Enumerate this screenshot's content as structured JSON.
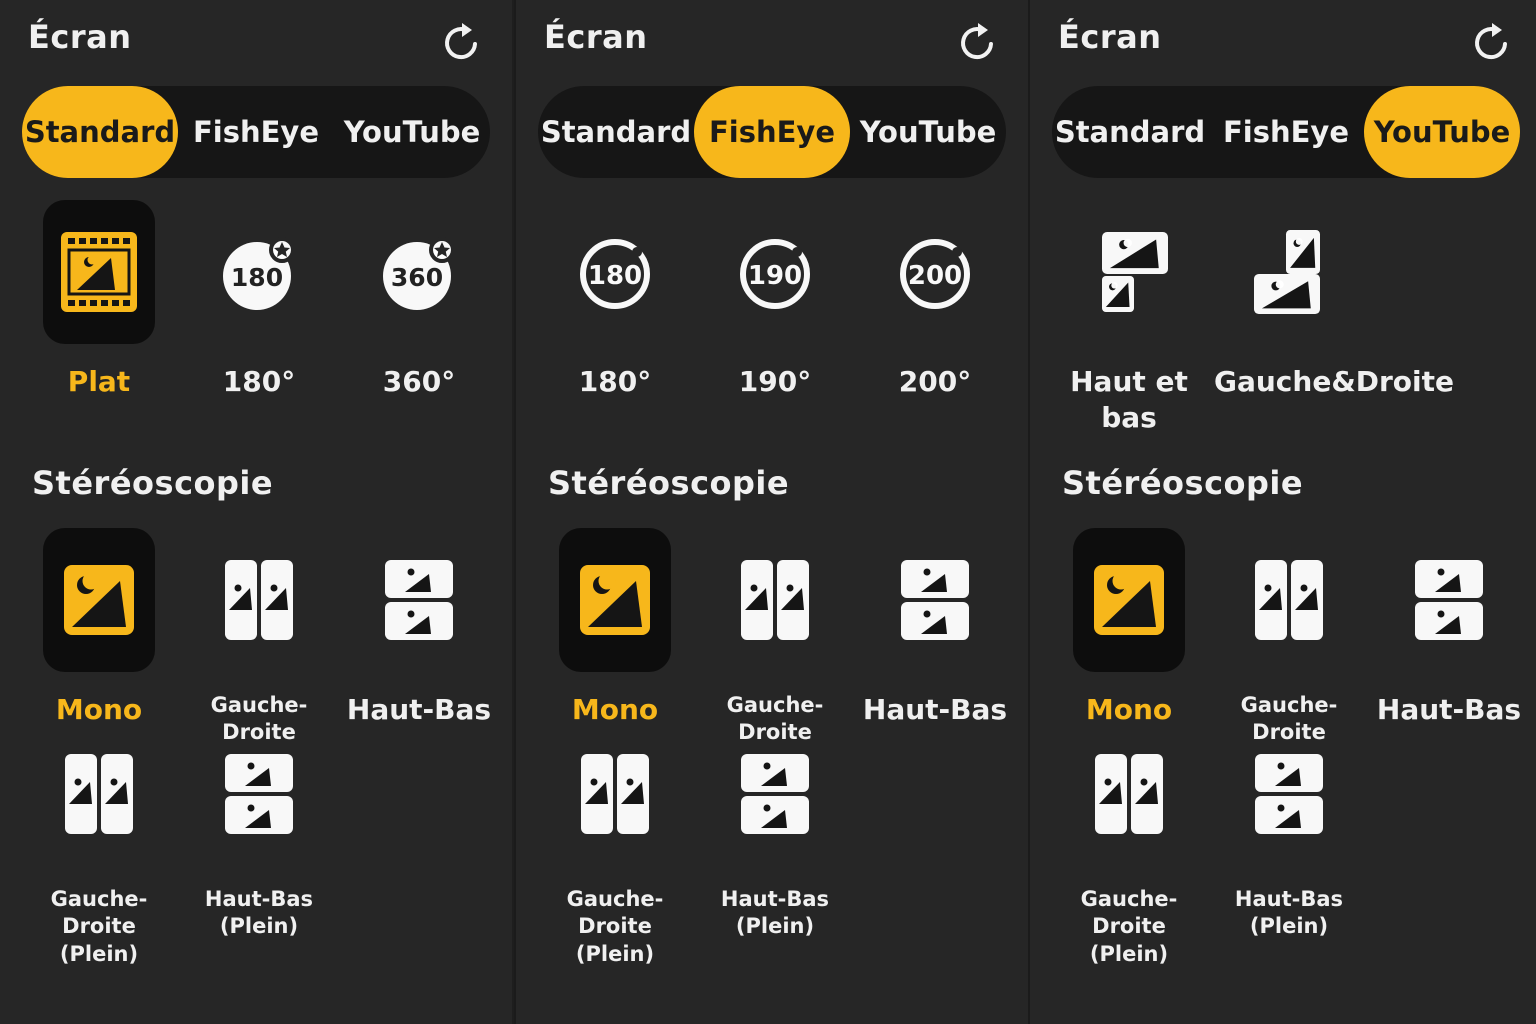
{
  "accent_color": "#f7b71b",
  "panels": [
    {
      "title": "Écran",
      "tabs": [
        "Standard",
        "FishEye",
        "YouTube"
      ],
      "active_tab": 0,
      "screen_options": [
        {
          "label": "Plat",
          "icon": "film-image-icon",
          "active": true
        },
        {
          "label": "180°",
          "icon": "sphere-180-icon",
          "badge": "180",
          "active": false
        },
        {
          "label": "360°",
          "icon": "sphere-360-icon",
          "badge": "360",
          "active": false
        }
      ],
      "stereo_title": "Stéréoscopie",
      "stereo_options": [
        {
          "label": "Mono",
          "icon": "mono-image-icon",
          "active": true
        },
        {
          "label": "Gauche-Droite",
          "icon": "side-by-side-icon",
          "active": false
        },
        {
          "label": "Haut-Bas",
          "icon": "top-bottom-icon",
          "active": false
        },
        {
          "label": "Gauche-Droite (Plein)",
          "icon": "side-by-side-full-icon",
          "active": false
        },
        {
          "label": "Haut-Bas (Plein)",
          "icon": "top-bottom-full-icon",
          "active": false
        }
      ]
    },
    {
      "title": "Écran",
      "tabs": [
        "Standard",
        "FishEye",
        "YouTube"
      ],
      "active_tab": 1,
      "screen_options": [
        {
          "label": "180°",
          "icon": "fisheye-180-icon",
          "badge": "180",
          "active": false
        },
        {
          "label": "190°",
          "icon": "fisheye-190-icon",
          "badge": "190",
          "active": false
        },
        {
          "label": "200°",
          "icon": "fisheye-200-icon",
          "badge": "200",
          "active": false
        }
      ],
      "stereo_title": "Stéréoscopie",
      "stereo_options": [
        {
          "label": "Mono",
          "icon": "mono-image-icon",
          "active": true
        },
        {
          "label": "Gauche-Droite",
          "icon": "side-by-side-icon",
          "active": false
        },
        {
          "label": "Haut-Bas",
          "icon": "top-bottom-icon",
          "active": false
        },
        {
          "label": "Gauche-Droite (Plein)",
          "icon": "side-by-side-full-icon",
          "active": false
        },
        {
          "label": "Haut-Bas (Plein)",
          "icon": "top-bottom-full-icon",
          "active": false
        }
      ]
    },
    {
      "title": "Écran",
      "tabs": [
        "Standard",
        "FishEye",
        "YouTube"
      ],
      "active_tab": 2,
      "screen_options": [
        {
          "label": "Haut et bas",
          "icon": "youtube-top-bottom-icon",
          "active": false
        },
        {
          "label": "Gauche&Droite",
          "icon": "youtube-left-right-icon",
          "active": false
        }
      ],
      "stereo_title": "Stéréoscopie",
      "stereo_options": [
        {
          "label": "Mono",
          "icon": "mono-image-icon",
          "active": true
        },
        {
          "label": "Gauche-Droite",
          "icon": "side-by-side-icon",
          "active": false
        },
        {
          "label": "Haut-Bas",
          "icon": "top-bottom-icon",
          "active": false
        },
        {
          "label": "Gauche-Droite (Plein)",
          "icon": "side-by-side-full-icon",
          "active": false
        },
        {
          "label": "Haut-Bas (Plein)",
          "icon": "top-bottom-full-icon",
          "active": false
        }
      ]
    }
  ]
}
